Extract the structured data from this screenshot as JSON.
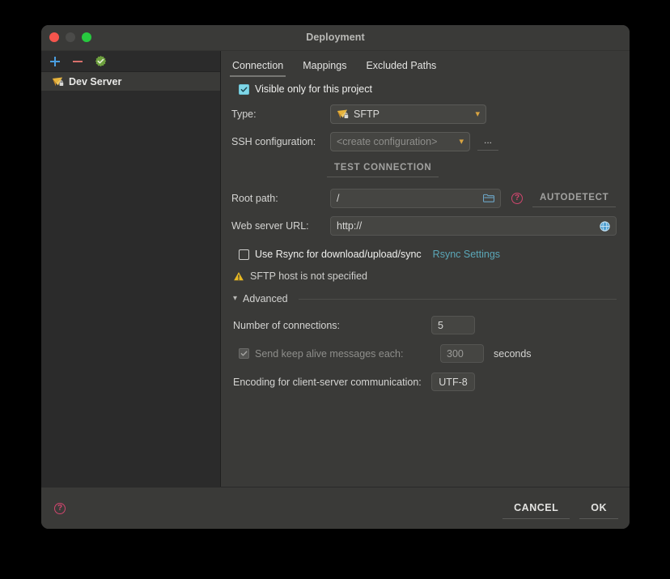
{
  "window": {
    "title": "Deployment",
    "traffic_lights": [
      "close-red",
      "minimize-gray",
      "zoom-green"
    ]
  },
  "sidebar": {
    "toolbar": {
      "add_label": "+",
      "remove_label": "−",
      "validate_icon": "green-check-badge-icon"
    },
    "items": [
      {
        "label": "Dev Server",
        "icon": "sftp-server-icon",
        "selected": true
      }
    ]
  },
  "tabs": [
    {
      "label": "Connection",
      "active": true
    },
    {
      "label": "Mappings",
      "active": false
    },
    {
      "label": "Excluded Paths",
      "active": false
    }
  ],
  "connection": {
    "visible_only_checkbox": {
      "label": "Visible only for this project",
      "checked": true
    },
    "type": {
      "label": "Type:",
      "value": "SFTP",
      "icon": "sftp-icon"
    },
    "ssh_configuration": {
      "label": "SSH configuration:",
      "value": "<create configuration>",
      "browse_label": "..."
    },
    "test_connection_label": "TEST CONNECTION",
    "root_path": {
      "label": "Root path:",
      "value": "/",
      "folder_icon": "folder-icon",
      "help_icon": "help-icon",
      "autodetect_label": "AUTODETECT"
    },
    "web_server_url": {
      "label": "Web server URL:",
      "placeholder": "http://",
      "value": "http://",
      "globe_icon": "globe-icon"
    },
    "rsync": {
      "checkbox_label": "Use Rsync for download/upload/sync",
      "checked": false,
      "settings_link": "Rsync Settings"
    },
    "warning": {
      "text": "SFTP host is not specified",
      "icon": "warning-triangle-icon"
    },
    "advanced": {
      "title": "Advanced",
      "expanded": true,
      "number_of_connections": {
        "label": "Number of connections:",
        "value": "5"
      },
      "keep_alive": {
        "label": "Send keep alive messages each:",
        "checked": true,
        "disabled": true,
        "value": "300",
        "unit": "seconds"
      },
      "encoding": {
        "label": "Encoding for client-server communication:",
        "value": "UTF-8"
      }
    }
  },
  "footer": {
    "help_icon": "help-icon",
    "cancel_label": "CANCEL",
    "ok_label": "OK"
  },
  "colors": {
    "window_bg": "#3a3a38",
    "sidebar_bg": "#2b2b2b",
    "field_bg": "#454542",
    "accent_checkbox": "#7fd7e8",
    "accent_link": "#5ba7b8",
    "accent_sftp": "#e0a13c",
    "accent_help": "#d0466e",
    "warning": "#e8b923"
  }
}
